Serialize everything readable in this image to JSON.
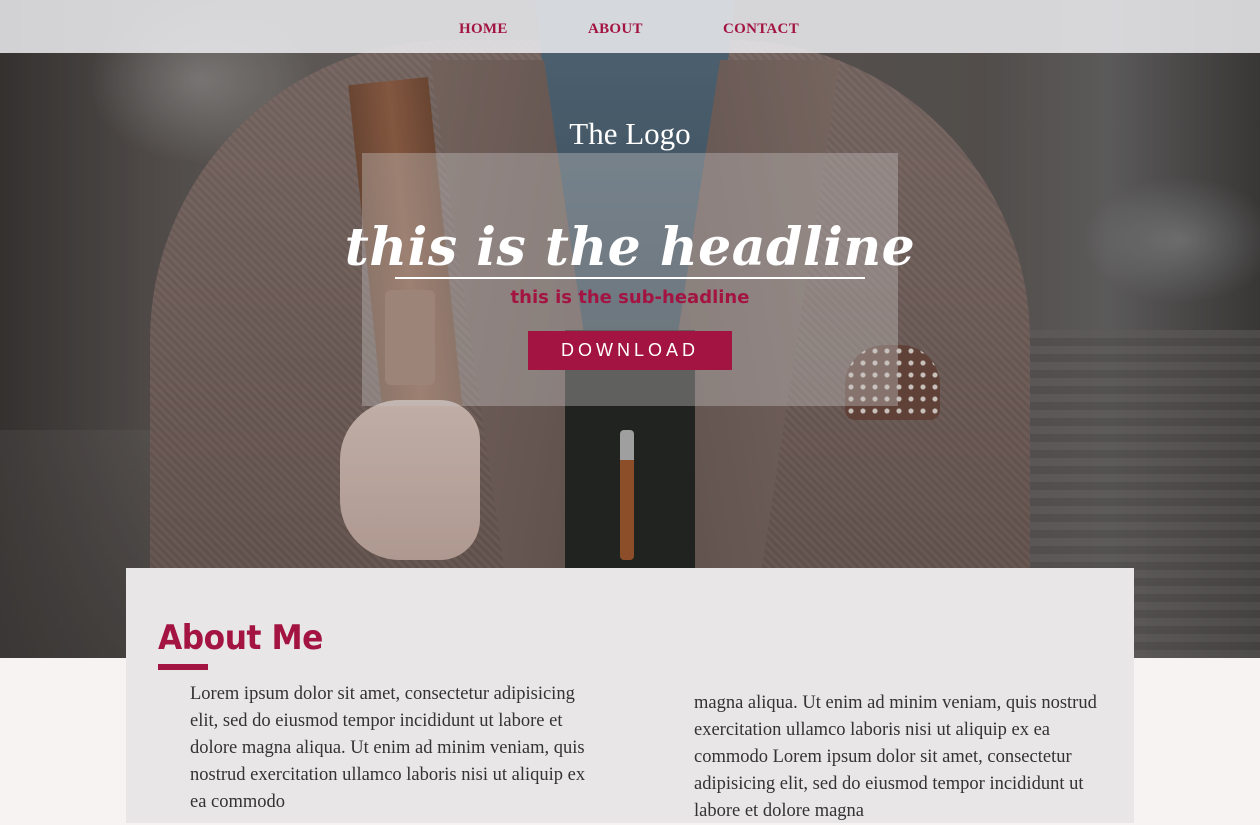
{
  "nav": {
    "items": [
      {
        "label": "HOME"
      },
      {
        "label": "ABOUT"
      },
      {
        "label": "CONTACT"
      }
    ]
  },
  "hero": {
    "logo": "The Logo",
    "headline": "this is the headline",
    "subheadline": "this is the sub-headline",
    "download_label": "DOWNLOAD"
  },
  "about": {
    "title": "About Me",
    "col_left": "Lorem ipsum dolor sit amet, consectetur adipisicing elit, sed do eiusmod tempor incididunt ut labore et dolore magna aliqua. Ut enim ad minim veniam, quis nostrud exercitation ullamco laboris nisi ut aliquip ex ea commodo",
    "col_right": "magna aliqua. Ut enim ad minim veniam, quis nostrud exercitation ullamco laboris nisi ut aliquip ex ea commodo Lorem ipsum dolor sit amet, consectetur adipisicing elit, sed do eiusmod tempor incididunt ut labore et dolore magna"
  },
  "colors": {
    "accent": "#a31442",
    "nav_bg": "#e8e8ec",
    "card_bg": "#e8e6e7",
    "page_bg": "#f7f3f3"
  }
}
